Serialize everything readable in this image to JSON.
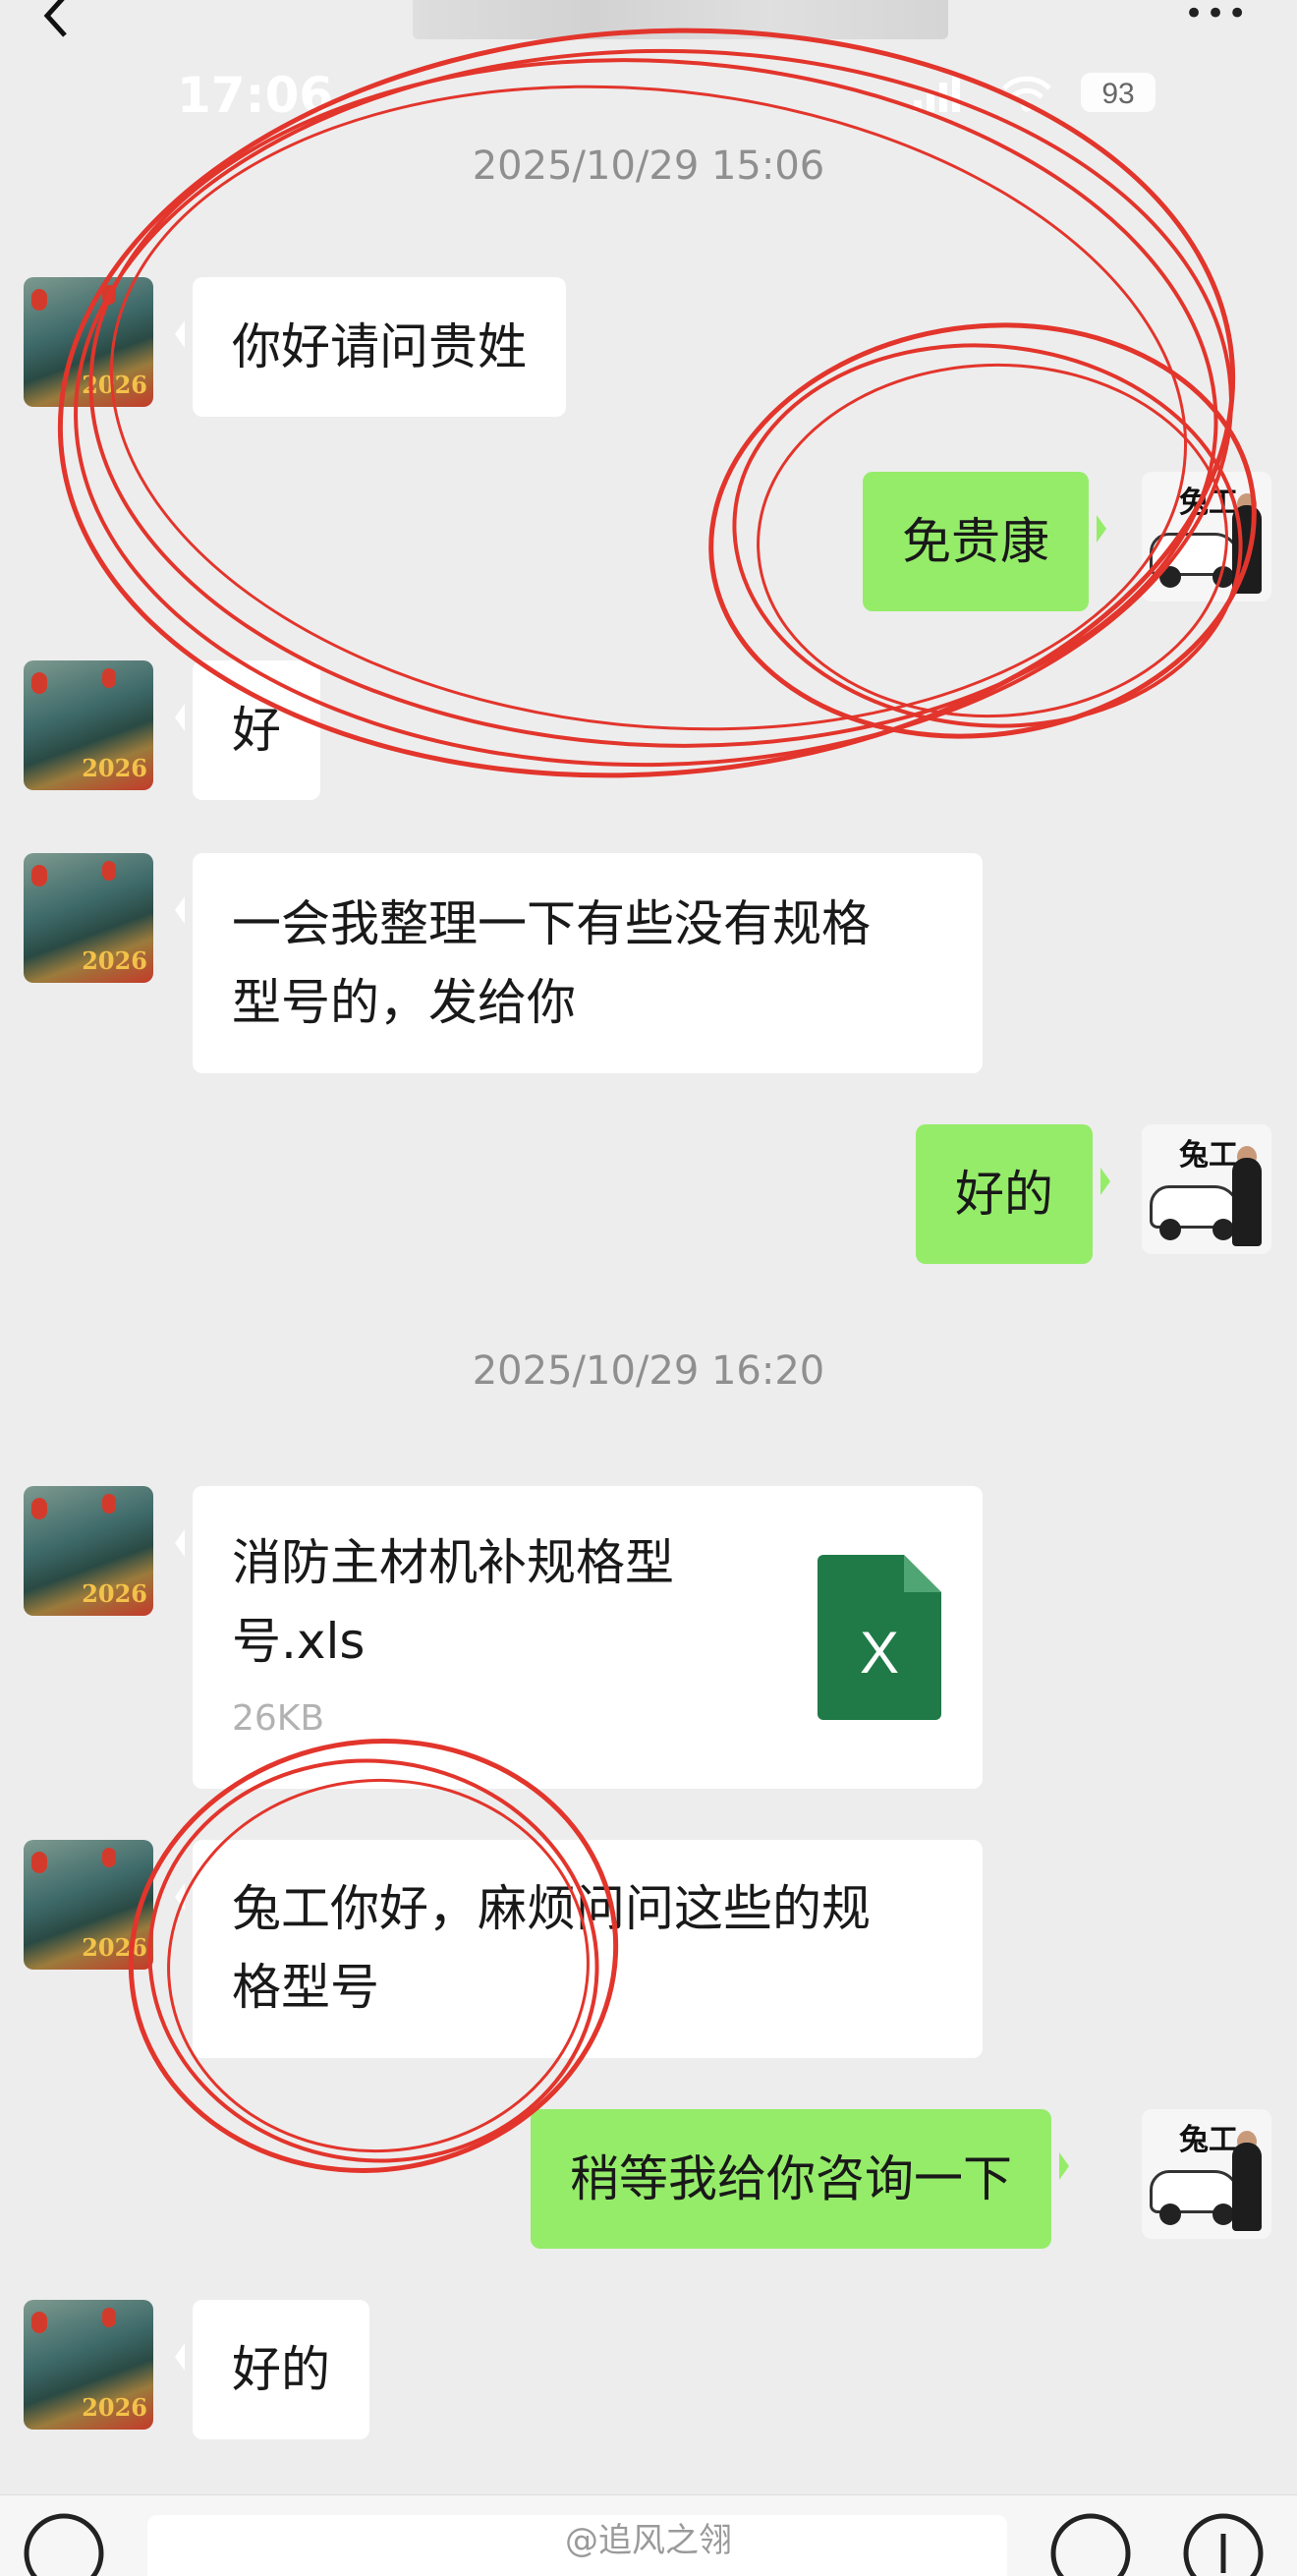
{
  "status_bar": {
    "time": "17:06",
    "battery": "93"
  },
  "header": {
    "back_icon": "chevron-left-icon",
    "more_label": "•••"
  },
  "messages": [
    {
      "type": "timestamp",
      "text": "2025/10/29 15:06"
    },
    {
      "type": "text",
      "side": "left",
      "text": "你好请问贵姓"
    },
    {
      "type": "text",
      "side": "right",
      "text": "免贵康"
    },
    {
      "type": "text",
      "side": "left",
      "text": "好"
    },
    {
      "type": "text",
      "side": "left",
      "line1": "一会我整理一下有些没有规格",
      "line2": "型号的，发给你"
    },
    {
      "type": "text",
      "side": "right",
      "text": "好的"
    },
    {
      "type": "timestamp",
      "text": "2025/10/29 16:20"
    },
    {
      "type": "file",
      "side": "left",
      "line1": "消防主材机补规格型",
      "line2": "号.xls",
      "size": "26KB",
      "icon_letter": "X"
    },
    {
      "type": "text",
      "side": "left",
      "line1": "兔工你好，麻烦问问这些的规",
      "line2": "格型号"
    },
    {
      "type": "text",
      "side": "right",
      "text": "稍等我给你咨询一下"
    },
    {
      "type": "text",
      "side": "left",
      "text": "好的"
    }
  ],
  "avatars": {
    "left_year": "2026",
    "right_label": "兔工"
  },
  "watermark": "@追风之翎",
  "colors": {
    "sent_bubble": "#95ec69",
    "received_bubble": "#ffffff",
    "background": "#ededed",
    "annotation": "#e2352c",
    "excel": "#1f7a47"
  }
}
